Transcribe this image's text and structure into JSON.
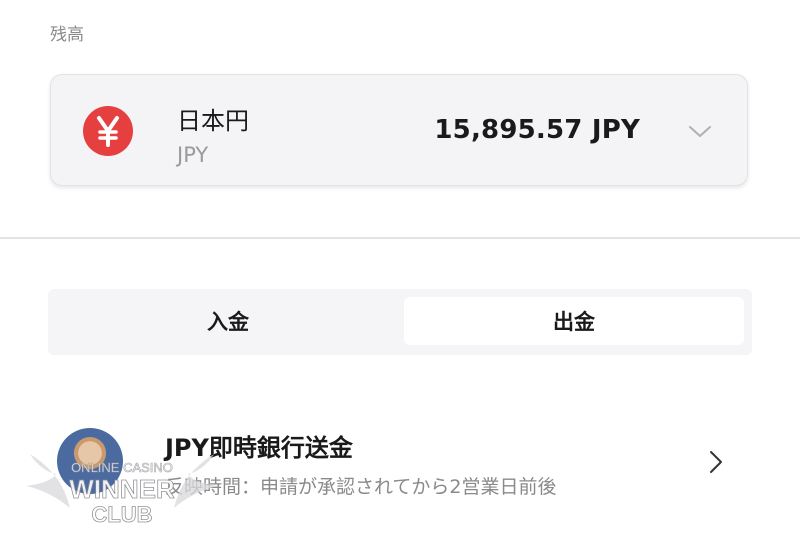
{
  "balance": {
    "section_label": "残高",
    "currency_name": "日本円",
    "currency_code": "JPY",
    "amount": "15,895.57 JPY",
    "icon": "yen-icon",
    "accent_color": "#e5403f"
  },
  "tabs": [
    {
      "label": "入金",
      "selected": false
    },
    {
      "label": "出金",
      "selected": true
    }
  ],
  "method": {
    "title": "JPY即時銀行送金",
    "subtitle": "反映時間：申請が承認されてから2営業日前後",
    "icon": "chevron-right-icon"
  },
  "watermark": {
    "line1": "ONLINE CASINO",
    "line2": "WINNER",
    "line3": "CLUB"
  }
}
